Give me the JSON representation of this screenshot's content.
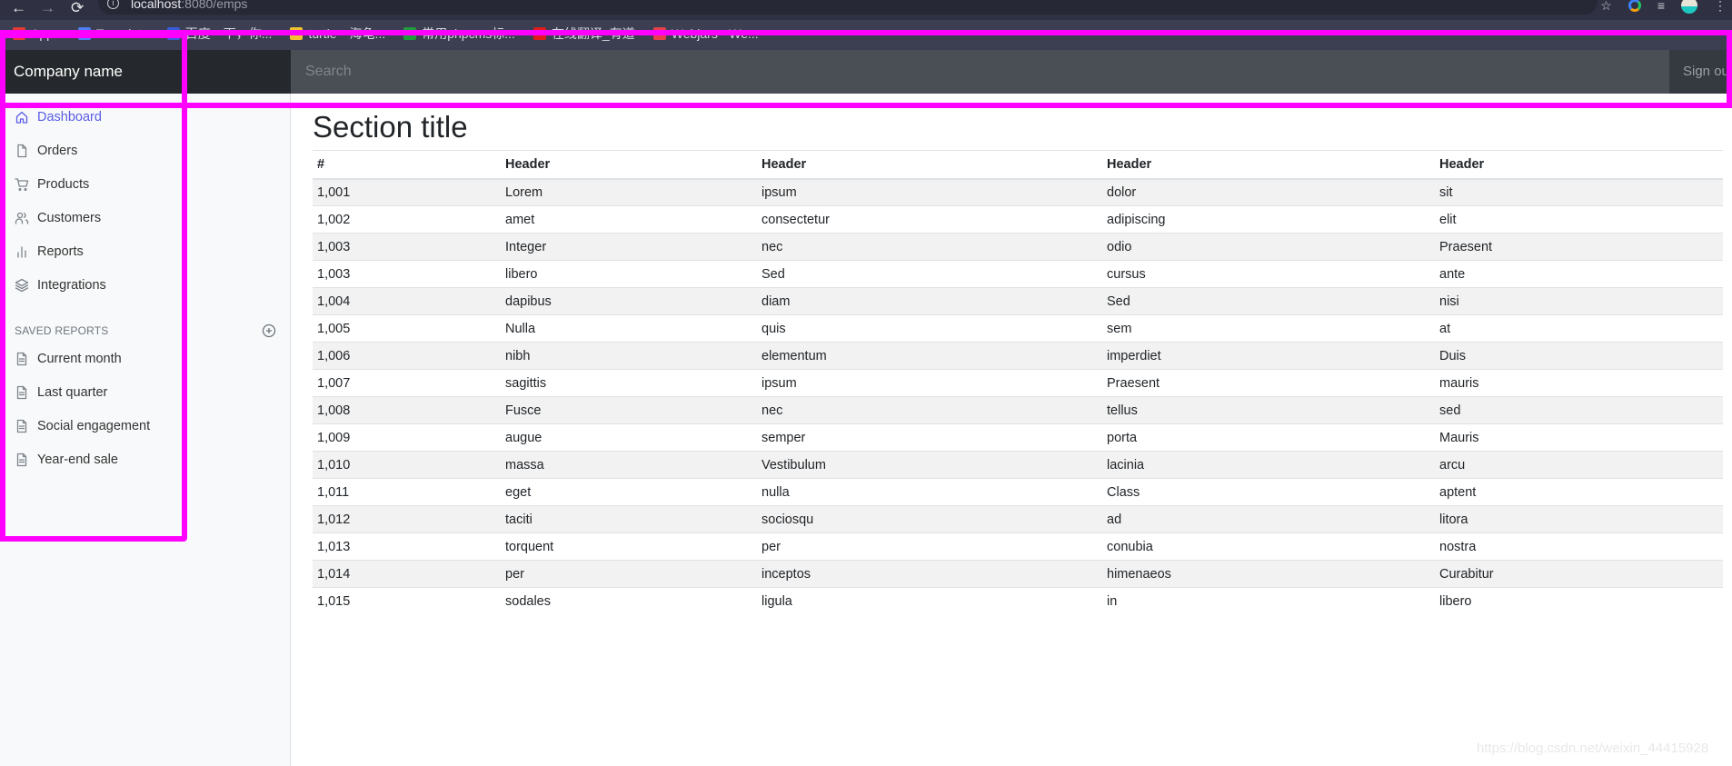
{
  "browser": {
    "url_host": "localhost",
    "url_path": ":8080/emps",
    "nav": {
      "back": "←",
      "forward": "→",
      "reload": "⟳"
    },
    "bookmarks": [
      {
        "label": "Apps",
        "color": "#e53935"
      },
      {
        "label": "Translate",
        "color": "#4f7ff0"
      },
      {
        "label": "百度一下，你...",
        "color": "#3a5bd9"
      },
      {
        "label": "turtle—海龟...",
        "color": "#f2c230"
      },
      {
        "label": "常用phpcms标...",
        "color": "#1f9d3a"
      },
      {
        "label": "在线翻译_有道",
        "color": "#e01b1b"
      },
      {
        "label": "Webjars - We...",
        "color": "#e8404a"
      }
    ]
  },
  "navbar": {
    "brand": "Company name",
    "search_placeholder": "Search",
    "signout": "Sign out"
  },
  "sidebar": {
    "items": [
      {
        "label": "Dashboard",
        "icon": "home-icon",
        "active": true
      },
      {
        "label": "Orders",
        "icon": "file-icon"
      },
      {
        "label": "Products",
        "icon": "shopping-cart-icon"
      },
      {
        "label": "Customers",
        "icon": "users-icon"
      },
      {
        "label": "Reports",
        "icon": "bar-chart-icon"
      },
      {
        "label": "Integrations",
        "icon": "layers-icon"
      }
    ],
    "saved_title": "SAVED REPORTS",
    "saved": [
      {
        "label": "Current month",
        "icon": "file-text-icon"
      },
      {
        "label": "Last quarter",
        "icon": "file-text-icon"
      },
      {
        "label": "Social engagement",
        "icon": "file-text-icon"
      },
      {
        "label": "Year-end sale",
        "icon": "file-text-icon"
      }
    ]
  },
  "main": {
    "title": "Section title",
    "headers": [
      "#",
      "Header",
      "Header",
      "Header",
      "Header"
    ],
    "rows": [
      [
        "1,001",
        "Lorem",
        "ipsum",
        "dolor",
        "sit"
      ],
      [
        "1,002",
        "amet",
        "consectetur",
        "adipiscing",
        "elit"
      ],
      [
        "1,003",
        "Integer",
        "nec",
        "odio",
        "Praesent"
      ],
      [
        "1,003",
        "libero",
        "Sed",
        "cursus",
        "ante"
      ],
      [
        "1,004",
        "dapibus",
        "diam",
        "Sed",
        "nisi"
      ],
      [
        "1,005",
        "Nulla",
        "quis",
        "sem",
        "at"
      ],
      [
        "1,006",
        "nibh",
        "elementum",
        "imperdiet",
        "Duis"
      ],
      [
        "1,007",
        "sagittis",
        "ipsum",
        "Praesent",
        "mauris"
      ],
      [
        "1,008",
        "Fusce",
        "nec",
        "tellus",
        "sed"
      ],
      [
        "1,009",
        "augue",
        "semper",
        "porta",
        "Mauris"
      ],
      [
        "1,010",
        "massa",
        "Vestibulum",
        "lacinia",
        "arcu"
      ],
      [
        "1,011",
        "eget",
        "nulla",
        "Class",
        "aptent"
      ],
      [
        "1,012",
        "taciti",
        "sociosqu",
        "ad",
        "litora"
      ],
      [
        "1,013",
        "torquent",
        "per",
        "conubia",
        "nostra"
      ],
      [
        "1,014",
        "per",
        "inceptos",
        "himenaeos",
        "Curabitur"
      ],
      [
        "1,015",
        "sodales",
        "ligula",
        "in",
        "libero"
      ]
    ]
  },
  "watermark": "https://blog.csdn.net/weixin_44415928",
  "annotation_color": "#ff00ff"
}
